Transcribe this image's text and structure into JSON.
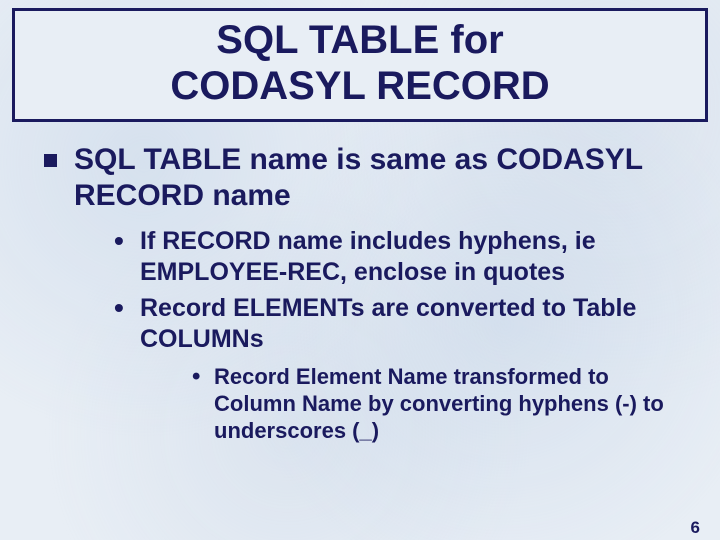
{
  "title": {
    "line1": "SQL TABLE for",
    "line2": "CODASYL RECORD"
  },
  "bullets": {
    "l1_0": "SQL TABLE name is same as CODASYL RECORD name",
    "l2_0": "If RECORD name includes hyphens, ie EMPLOYEE-REC, enclose in quotes",
    "l2_1": "Record ELEMENTs are converted to Table COLUMNs",
    "l3_0": "Record Element Name transformed to Column Name by converting hyphens (-) to underscores (_)"
  },
  "page_number": "6"
}
